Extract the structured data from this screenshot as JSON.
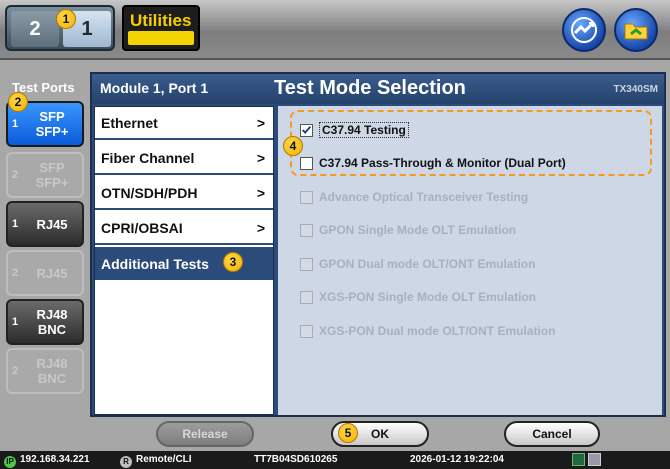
{
  "topbar": {
    "view_buttons": [
      "2",
      "1"
    ],
    "utilities_label": "Utilities",
    "quick_icon": "signal-quick-icon",
    "files_icon": "folder-icon"
  },
  "ports": {
    "title": "Test Ports",
    "items": [
      {
        "num": "1",
        "label": "SFP\nSFP+",
        "state": "selected"
      },
      {
        "num": "2",
        "label": "SFP\nSFP+",
        "state": "disabled"
      },
      {
        "num": "1",
        "label": "RJ45",
        "state": "active"
      },
      {
        "num": "2",
        "label": "RJ45",
        "state": "disabled"
      },
      {
        "num": "1",
        "label": "RJ48\nBNC",
        "state": "active"
      },
      {
        "num": "2",
        "label": "RJ48\nBNC",
        "state": "disabled"
      }
    ]
  },
  "panel": {
    "module": "Module 1, Port 1",
    "title": "Test Mode Selection",
    "model": "TX340SM"
  },
  "nav": [
    {
      "label": "Ethernet",
      "arrow": ">"
    },
    {
      "label": "Fiber Channel",
      "arrow": ">"
    },
    {
      "label": "OTN/SDH/PDH",
      "arrow": ">"
    },
    {
      "label": "CPRI/OBSAI",
      "arrow": ">"
    },
    {
      "label": "Additional Tests",
      "arrow": ""
    }
  ],
  "options": [
    {
      "label": "C37.94 Testing",
      "checked": true,
      "enabled": true
    },
    {
      "label": "C37.94 Pass-Through & Monitor (Dual Port)",
      "checked": false,
      "enabled": true
    },
    {
      "label": "Advance Optical Transceiver Testing",
      "checked": false,
      "enabled": false
    },
    {
      "label": "GPON Single Mode OLT Emulation",
      "checked": false,
      "enabled": false
    },
    {
      "label": "GPON Dual mode OLT/ONT Emulation",
      "checked": false,
      "enabled": false
    },
    {
      "label": "XGS-PON Single Mode OLT Emulation",
      "checked": false,
      "enabled": false
    },
    {
      "label": "XGS-PON Dual mode OLT/ONT Emulation",
      "checked": false,
      "enabled": false
    }
  ],
  "buttons": {
    "release": "Release",
    "ok": "OK",
    "cancel": "Cancel"
  },
  "callouts": [
    "1",
    "2",
    "3",
    "4",
    "5"
  ],
  "status": {
    "ip": "192.168.34.221",
    "ip_badge": "IP",
    "remote_badge": "R",
    "remote": "Remote/CLI",
    "serial": "TT7B04SD610265",
    "datetime": "2026-01-12  19:22:04"
  },
  "colors": {
    "accent": "#2b4c7a",
    "selected_port": "#0a5bd8",
    "callout": "#f2b200",
    "highlight_box": "#f59a1a"
  }
}
